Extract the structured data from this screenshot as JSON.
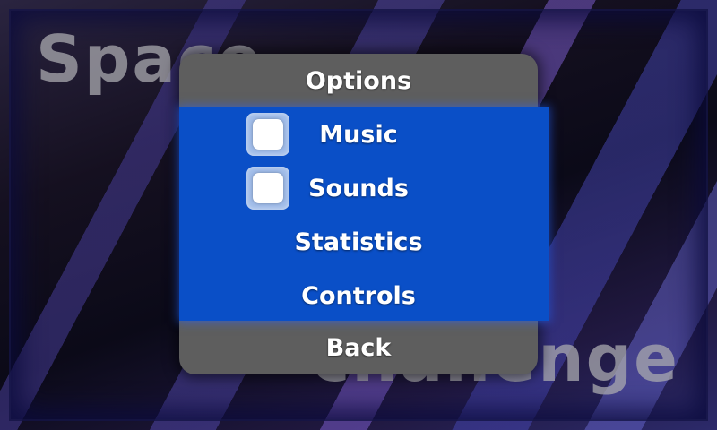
{
  "background": {
    "title_top": "Space",
    "title_bottom": "challenge"
  },
  "dialog": {
    "title": "Options",
    "options": [
      {
        "label": "Music",
        "checkbox": true,
        "checked": false
      },
      {
        "label": "Sounds",
        "checkbox": true,
        "checked": false
      },
      {
        "label": "Statistics",
        "checkbox": false
      },
      {
        "label": "Controls",
        "checkbox": false
      }
    ],
    "back_label": "Back"
  },
  "colors": {
    "dialog_gray": "#5e5e5e",
    "body_blue": "#0a4fc7",
    "text": "#ffffff"
  }
}
